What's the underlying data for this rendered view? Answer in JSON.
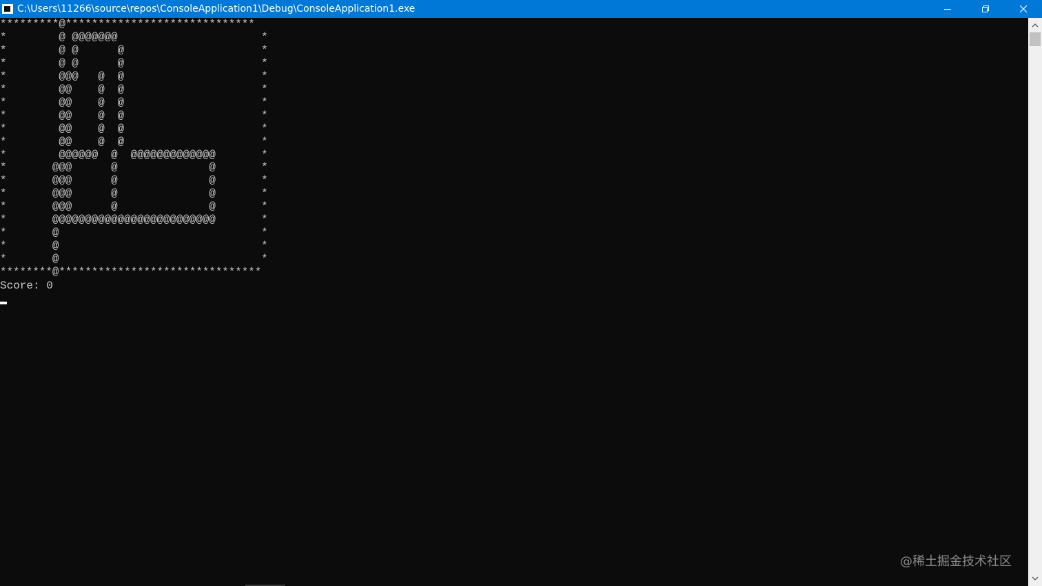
{
  "window": {
    "title": "C:\\Users\\11266\\source\\repos\\ConsoleApplication1\\Debug\\ConsoleApplication1.exe",
    "titlebar_color": "#0078d7",
    "icon": "console-app-icon",
    "controls": {
      "minimize_icon": "minimize-icon",
      "restore_icon": "restore-icon",
      "close_icon": "close-icon"
    }
  },
  "console": {
    "background": "#0c0c0c",
    "foreground": "#cccccc",
    "board": "*********@*****************************\n*        @ @@@@@@@                      *\n*        @ @      @                     *\n*        @ @      @                     *\n*        @@@   @  @                     *\n*        @@    @  @                     *\n*        @@    @  @                     *\n*        @@    @  @                     *\n*        @@    @  @                     *\n*        @@    @  @                     *\n*        @@@@@@  @  @@@@@@@@@@@@@       *\n*       @@@      @              @       *\n*       @@@      @              @       *\n*       @@@      @              @       *\n*       @@@      @              @       *\n*       @@@@@@@@@@@@@@@@@@@@@@@@@       *\n*       @                               *\n*       @                               *\n*       @                               *\n********@*******************************",
    "score_line": "Score: 0"
  },
  "watermark": "@稀土掘金技术社区",
  "scrollbar": {
    "up_icon": "scroll-up-arrow-icon",
    "down_icon": "scroll-down-arrow-icon"
  }
}
